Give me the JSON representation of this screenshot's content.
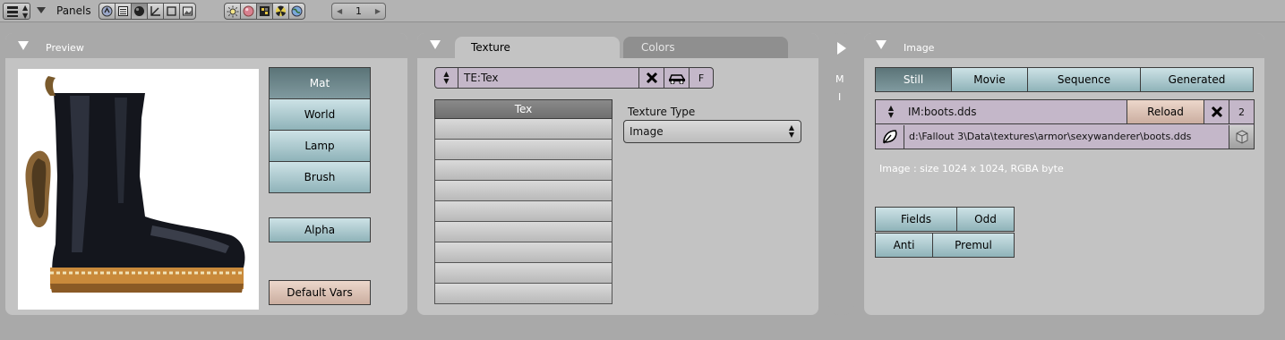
{
  "header": {
    "panels_label": "Panels",
    "view_icons": [
      "material-icon",
      "texture-icon",
      "sphere-icon",
      "armature-icon",
      "object-icon",
      "image-icon"
    ],
    "shade_icons": [
      "lamp-icon",
      "material-ball-icon",
      "texture-checker-icon",
      "radiation-icon",
      "world-icon"
    ],
    "number_value": "1"
  },
  "preview": {
    "title": "Preview",
    "buttons": {
      "mat": "Mat",
      "world": "World",
      "lamp": "Lamp",
      "brush": "Brush"
    },
    "alpha": "Alpha",
    "default_vars": "Default Vars"
  },
  "texture": {
    "tabs": [
      "Texture",
      "Colors"
    ],
    "texture_name": "TE:Tex",
    "f_label": "F",
    "list_header": "Tex",
    "list_rows": 9,
    "type_label": "Texture Type",
    "type_value": "Image"
  },
  "narrow_panel": {
    "letters": [
      "M",
      "I"
    ]
  },
  "image": {
    "title": "Image",
    "source_buttons": [
      "Still",
      "Movie",
      "Sequence",
      "Generated"
    ],
    "image_name": "IM:boots.dds",
    "reload": "Reload",
    "users": "2",
    "path": "d:\\Fallout 3\\Data\\textures\\armor\\sexywanderer\\boots.dds",
    "info": "Image : size 1024 x 1024, RGBA byte",
    "fields": "Fields",
    "odd": "Odd",
    "anti": "Anti",
    "premul": "Premul"
  },
  "colors": {
    "panel_bg": "#c3c3c3",
    "header_bg": "#a9a9a9",
    "button_blue": "#a8c8cd",
    "button_active": "#6d878b",
    "field_purple": "#c4b7c9"
  }
}
